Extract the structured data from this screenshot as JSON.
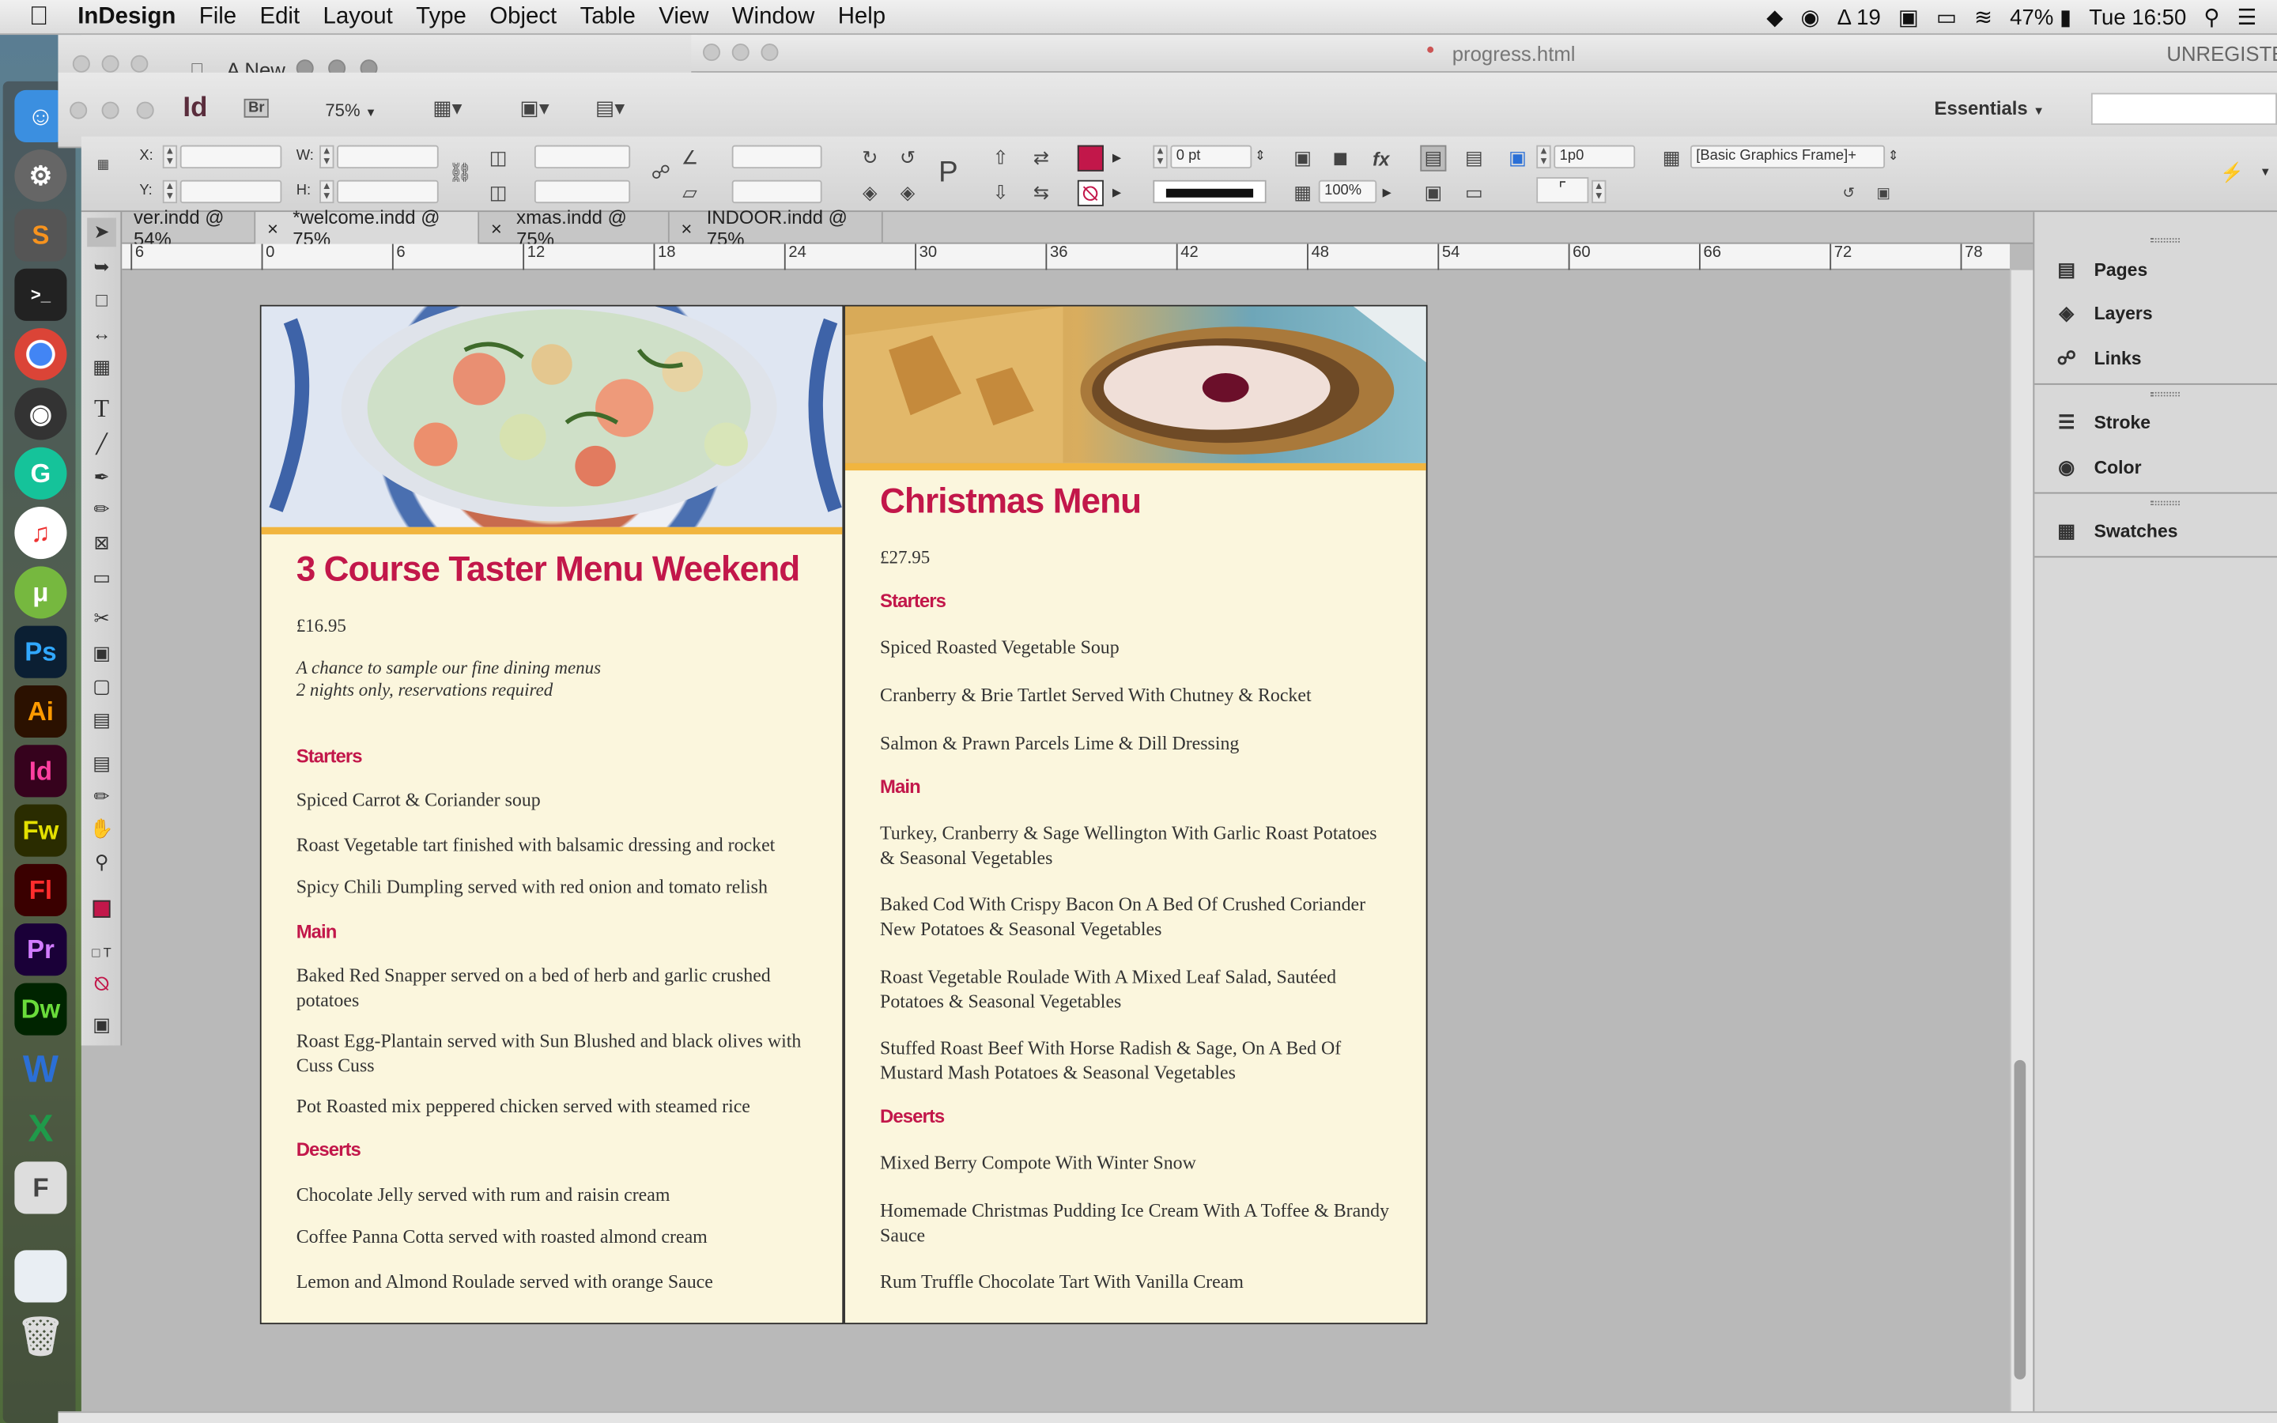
{
  "menubar": {
    "app_name": "InDesign",
    "items": [
      "File",
      "Edit",
      "Layout",
      "Type",
      "Object",
      "Table",
      "View",
      "Window",
      "Help"
    ],
    "status": {
      "notifications": "19",
      "battery": "47%",
      "clock": "Tue 16:50"
    }
  },
  "windows": {
    "doc_title": "A New",
    "browser_title": "progress.html",
    "unregistered": "UNREGISTE"
  },
  "appbar": {
    "logo": "Id",
    "bridge": "Br",
    "zoom": "75%",
    "workspace": "Essentials"
  },
  "control": {
    "x_label": "X:",
    "y_label": "Y:",
    "w_label": "W:",
    "h_label": "H:",
    "stroke_weight": "0 pt",
    "opacity": "100%",
    "gap": "1p0",
    "object_style": "[Basic Graphics Frame]+",
    "fill_color": "#c2174a"
  },
  "tabs": [
    {
      "label": "ver.indd @ 54%",
      "active": false
    },
    {
      "label": "*welcome.indd @ 75%",
      "active": true
    },
    {
      "label": "xmas.indd @ 75%",
      "active": false
    },
    {
      "label": "INDOOR.indd @ 75%",
      "active": false
    }
  ],
  "ruler": [
    "6",
    "0",
    "6",
    "12",
    "18",
    "24",
    "30",
    "36",
    "42",
    "48",
    "54",
    "60",
    "66",
    "72",
    "78"
  ],
  "taster": {
    "title": "3 Course Taster Menu Weekend",
    "price": "£16.95",
    "intro_line1": "A chance to sample our fine dining menus",
    "intro_line2": "2 nights only, reservations required",
    "starters_heading": "Starters",
    "starters": [
      "Spiced Carrot & Coriander soup",
      "Roast Vegetable tart finished with balsamic dressing and rocket",
      "Spicy Chili Dumpling served with red onion and tomato relish"
    ],
    "main_heading": "Main",
    "mains": [
      "Baked Red Snapper served on a bed of herb and garlic crushed potatoes",
      "Roast Egg-Plantain served with Sun Blushed and black olives with Cuss Cuss",
      "Pot Roasted mix peppered chicken served with steamed rice"
    ],
    "deserts_heading": "Deserts",
    "deserts": [
      "Chocolate Jelly served with rum and raisin cream",
      "Coffee Panna Cotta served with roasted almond cream",
      "Lemon and Almond Roulade served with orange Sauce"
    ]
  },
  "christmas": {
    "title": "Christmas Menu",
    "price": "£27.95",
    "starters_heading": "Starters",
    "starters": [
      "Spiced Roasted Vegetable Soup",
      "Cranberry & Brie Tartlet Served With Chutney & Rocket",
      "Salmon & Prawn Parcels Lime & Dill Dressing"
    ],
    "main_heading": "Main",
    "mains": [
      "Turkey, Cranberry & Sage Wellington With Garlic Roast Potatoes & Seasonal Vegetables",
      "Baked Cod With Crispy Bacon On A Bed Of Crushed Coriander New Potatoes & Seasonal Vegetables",
      "Roast Vegetable Roulade With A Mixed Leaf Salad, Sautéed Potatoes & Seasonal Vegetables",
      "Stuffed Roast Beef With Horse Radish & Sage, On A Bed Of Mustard Mash Potatoes & Seasonal Vegetables"
    ],
    "deserts_heading": "Deserts",
    "deserts": [
      "Mixed Berry Compote With Winter Snow",
      "Homemade Christmas Pudding Ice Cream With A Toffee & Brandy Sauce",
      "Rum Truffle Chocolate Tart With Vanilla Cream"
    ]
  },
  "panels": [
    "Pages",
    "Layers",
    "Links",
    "Stroke",
    "Color",
    "Swatches"
  ],
  "dock": [
    "Ps",
    "Ai",
    "Id",
    "Fw",
    "Fl",
    "Pr",
    "Dw"
  ],
  "colors": {
    "accent": "#c2174a",
    "band": "#f1b53f",
    "page": "#fbf6dd"
  }
}
